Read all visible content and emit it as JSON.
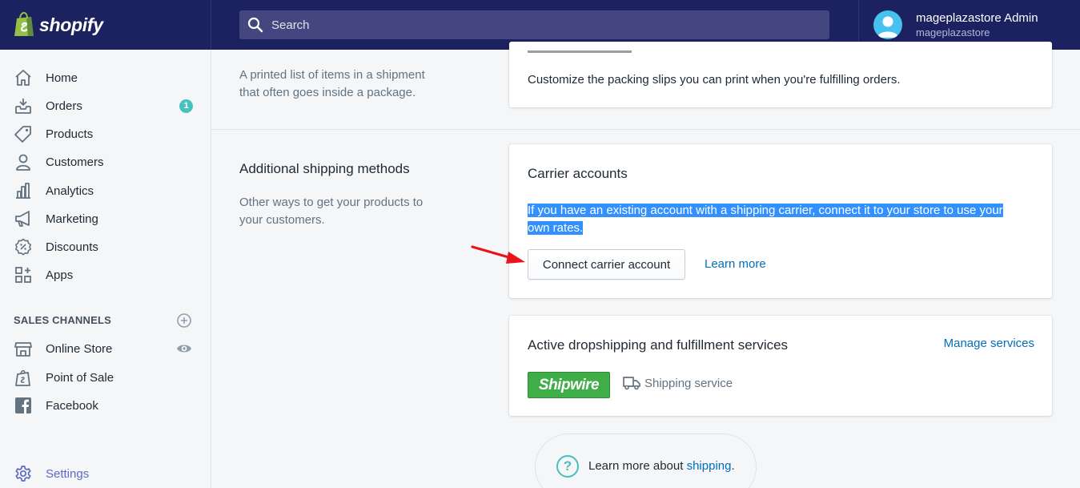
{
  "app": {
    "brand": "shopify",
    "search_placeholder": "Search",
    "account_name": "mageplazastore Admin",
    "store_name": "mageplazastore"
  },
  "sidebar": {
    "items": [
      {
        "label": "Home",
        "icon": "home-icon"
      },
      {
        "label": "Orders",
        "icon": "orders-icon",
        "badge": "1"
      },
      {
        "label": "Products",
        "icon": "tag-icon"
      },
      {
        "label": "Customers",
        "icon": "person-icon"
      },
      {
        "label": "Analytics",
        "icon": "bar-chart-icon"
      },
      {
        "label": "Marketing",
        "icon": "megaphone-icon"
      },
      {
        "label": "Discounts",
        "icon": "discount-icon"
      },
      {
        "label": "Apps",
        "icon": "apps-icon"
      }
    ],
    "sales_channels_heading": "SALES CHANNELS",
    "channels": [
      {
        "label": "Online Store",
        "icon": "storefront-icon"
      },
      {
        "label": "Point of Sale",
        "icon": "shopping-bag-icon"
      },
      {
        "label": "Facebook",
        "icon": "facebook-icon"
      }
    ],
    "settings_label": "Settings",
    "accent_color": "#5c6ac4",
    "badge_color": "#47c1bf"
  },
  "packing_slip": {
    "description": "A printed list of items in a shipment that often goes inside a package.",
    "card_text": "Customize the packing slips you can print when you're fulfilling orders."
  },
  "shipping_methods": {
    "title": "Additional shipping methods",
    "description": "Other ways to get your products to your customers."
  },
  "carrier_card": {
    "title": "Carrier accounts",
    "line1": "If you have an existing account with a shipping carrier, connect it to your store to use your",
    "line2": "own rates.",
    "button_label": "Connect carrier account",
    "learn_more": "Learn more"
  },
  "dropship_card": {
    "title": "Active dropshipping and fulfillment services",
    "manage_link": "Manage services",
    "logo_text": "Shipwire",
    "service_label": "Shipping service"
  },
  "help": {
    "prefix": "Learn more about ",
    "link": "shipping",
    "suffix": "."
  },
  "colors": {
    "topbar": "#1c2260",
    "link": "#006fbb",
    "selection": "#3390ff",
    "annotation_arrow": "#e8141a"
  }
}
